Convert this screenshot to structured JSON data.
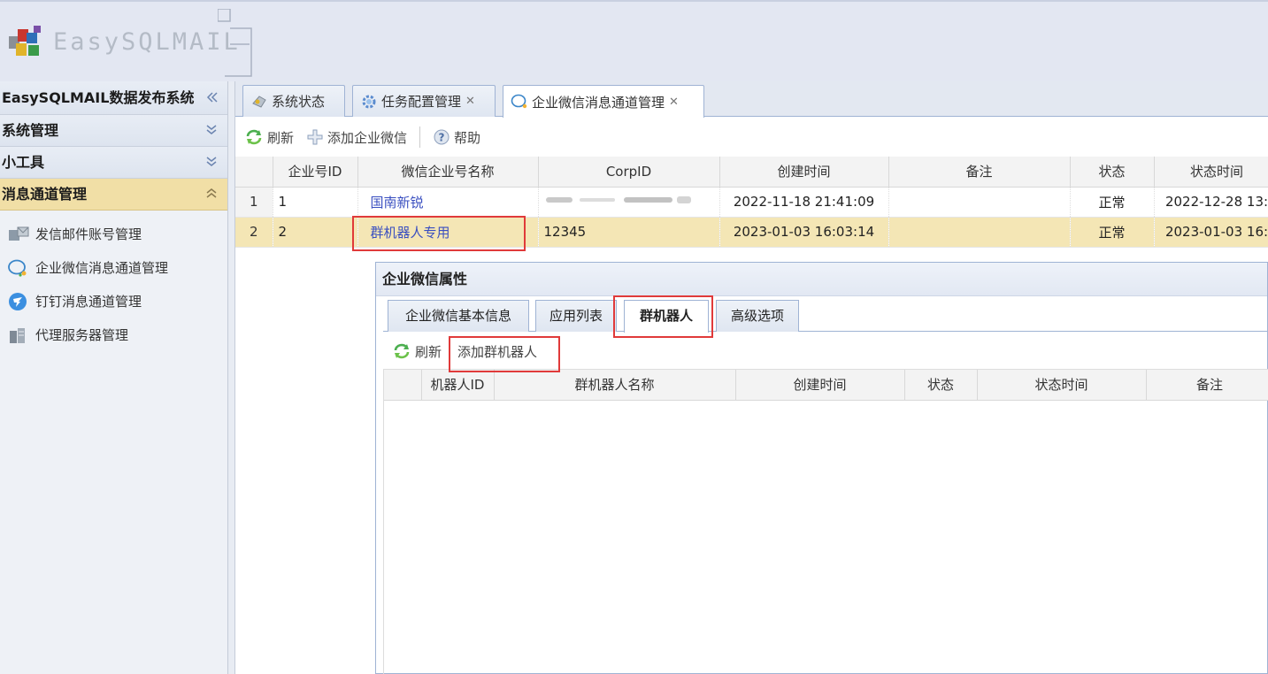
{
  "app": {
    "logo_text": "EasySQLMAIL"
  },
  "sidebar": {
    "system_title": "EasySQLMAIL数据发布系统",
    "sections": [
      {
        "label": "系统管理"
      },
      {
        "label": "小工具"
      },
      {
        "label": "消息通道管理"
      }
    ],
    "items": [
      {
        "label": "发信邮件账号管理",
        "icon": "mail-server-icon"
      },
      {
        "label": "企业微信消息通道管理",
        "icon": "chat-bubble-icon"
      },
      {
        "label": "钉钉消息通道管理",
        "icon": "dingtalk-icon"
      },
      {
        "label": "代理服务器管理",
        "icon": "proxy-server-icon"
      }
    ]
  },
  "tabs": [
    {
      "label": "系统状态",
      "icon": "status-icon"
    },
    {
      "label": "任务配置管理",
      "icon": "gear-icon",
      "closable": true
    },
    {
      "label": "企业微信消息通道管理",
      "icon": "chat-bubble-icon",
      "closable": true,
      "active": true
    }
  ],
  "toolbar": {
    "refresh": "刷新",
    "add": "添加企业微信",
    "help": "帮助"
  },
  "grid": {
    "columns": [
      "企业号ID",
      "微信企业号名称",
      "CorpID",
      "创建时间",
      "备注",
      "状态",
      "状态时间"
    ],
    "rows": [
      {
        "rownum": "1",
        "id": "1",
        "name": "国南新锐",
        "corpid": "",
        "created": "2022-11-18 21:41:09",
        "note": "",
        "status": "正常",
        "status_time": "2022-12-28 13:"
      },
      {
        "rownum": "2",
        "id": "2",
        "name": "群机器人专用",
        "corpid": "12345",
        "created": "2023-01-03 16:03:14",
        "note": "",
        "status": "正常",
        "status_time": "2023-01-03 16:",
        "selected": true
      }
    ]
  },
  "panel": {
    "title": "企业微信属性",
    "tabs": [
      {
        "label": "企业微信基本信息"
      },
      {
        "label": "应用列表"
      },
      {
        "label": "群机器人",
        "active": true
      },
      {
        "label": "高级选项"
      }
    ],
    "toolbar": {
      "refresh": "刷新",
      "add": "添加群机器人"
    },
    "columns": [
      "机器人ID",
      "群机器人名称",
      "创建时间",
      "状态",
      "状态时间",
      "备注"
    ]
  },
  "colors": {
    "highlight": "#e03a3a",
    "selected_row": "#f4e6b5",
    "active_section": "#f1dfa6"
  }
}
